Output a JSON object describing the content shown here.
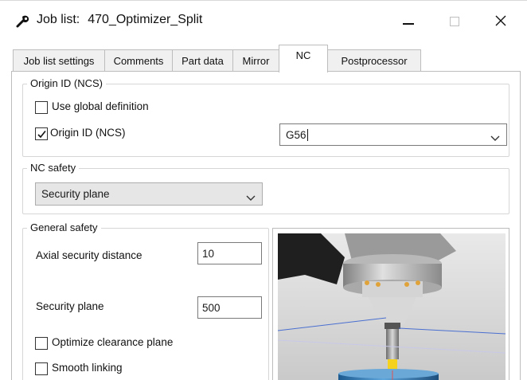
{
  "window": {
    "title_prefix": "Job list:",
    "title_name": "470_Optimizer_Split",
    "minimize_glyph": "—",
    "close_glyph": "✕",
    "icon": "tool-icon"
  },
  "tabs": [
    {
      "label": "Job list settings",
      "active": false
    },
    {
      "label": "Comments",
      "active": false
    },
    {
      "label": "Part data",
      "active": false
    },
    {
      "label": "Mirror",
      "active": false
    },
    {
      "label": "NC",
      "active": true
    },
    {
      "label": "Postprocessor",
      "active": false
    }
  ],
  "origin_group": {
    "title": "Origin ID (NCS)",
    "use_global": {
      "label": "Use global definition",
      "checked": false
    },
    "origin_id": {
      "label": "Origin ID (NCS)",
      "checked": true
    },
    "origin_value": "G56"
  },
  "nc_safety": {
    "title": "NC safety",
    "selected": "Security plane"
  },
  "general_safety": {
    "title": "General safety",
    "axial_label": "Axial security distance",
    "axial_value": "10",
    "plane_label": "Security plane",
    "plane_value": "500",
    "optimize": {
      "label": "Optimize clearance plane",
      "checked": false
    },
    "smooth": {
      "label": "Smooth linking",
      "checked": false
    }
  },
  "colors": {
    "accent_blue": "#2f6fa8",
    "tool_yellow": "#f5d21e"
  }
}
